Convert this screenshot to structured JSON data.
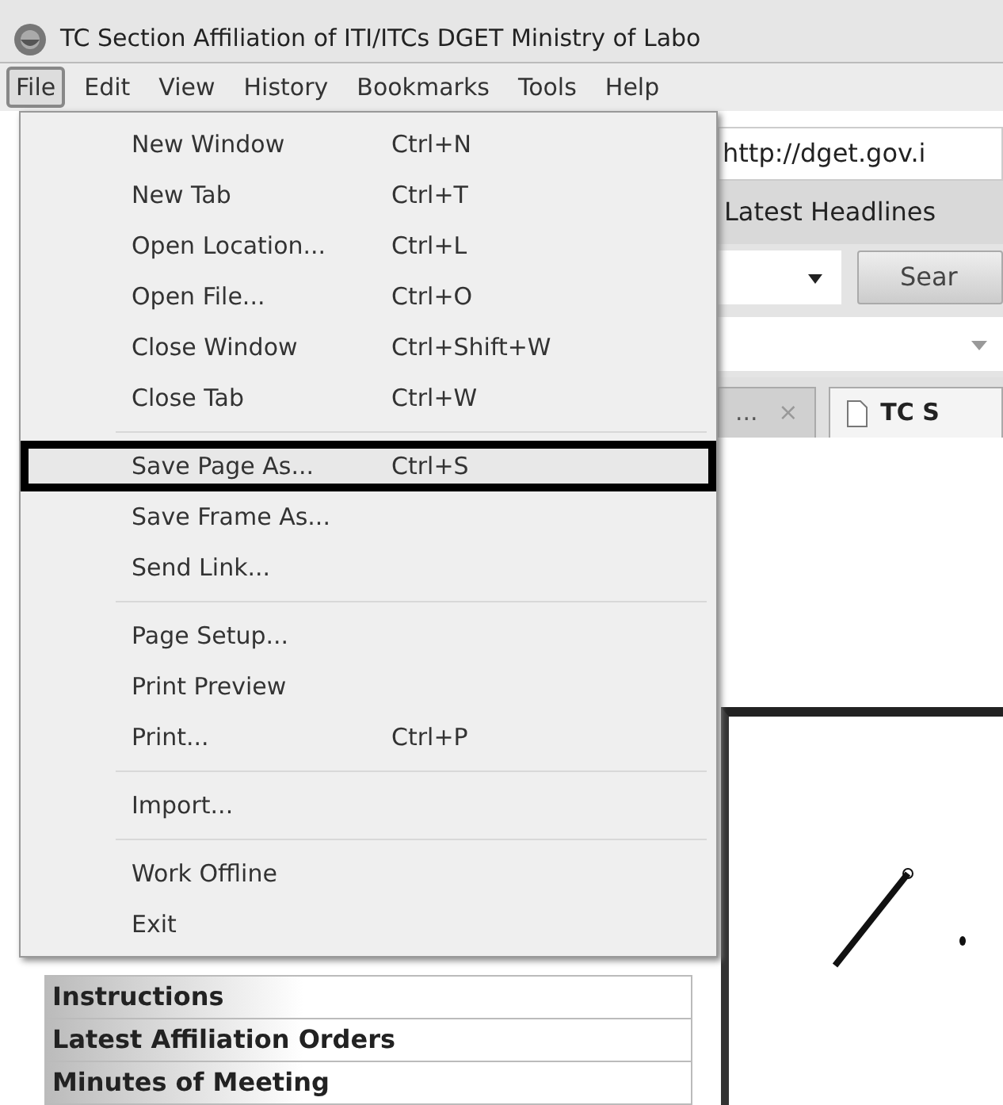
{
  "window": {
    "title": "TC Section Affiliation of ITI/ITCs DGET Ministry of Labo"
  },
  "menubar": [
    {
      "label": "File",
      "selected": true
    },
    {
      "label": "Edit",
      "selected": false
    },
    {
      "label": "View",
      "selected": false
    },
    {
      "label": "History",
      "selected": false
    },
    {
      "label": "Bookmarks",
      "selected": false
    },
    {
      "label": "Tools",
      "selected": false
    },
    {
      "label": "Help",
      "selected": false
    }
  ],
  "file_menu": [
    {
      "kind": "item",
      "label": "New Window",
      "shortcut": "Ctrl+N",
      "selected": false
    },
    {
      "kind": "item",
      "label": "New Tab",
      "shortcut": "Ctrl+T",
      "selected": false
    },
    {
      "kind": "item",
      "label": "Open Location...",
      "shortcut": "Ctrl+L",
      "selected": false
    },
    {
      "kind": "item",
      "label": "Open File...",
      "shortcut": "Ctrl+O",
      "selected": false
    },
    {
      "kind": "item",
      "label": "Close Window",
      "shortcut": "Ctrl+Shift+W",
      "selected": false
    },
    {
      "kind": "item",
      "label": "Close Tab",
      "shortcut": "Ctrl+W",
      "selected": false
    },
    {
      "kind": "separator"
    },
    {
      "kind": "item",
      "label": "Save Page As...",
      "shortcut": "Ctrl+S",
      "selected": true
    },
    {
      "kind": "item",
      "label": "Save Frame As...",
      "selected": false
    },
    {
      "kind": "item",
      "label": "Send Link...",
      "selected": false
    },
    {
      "kind": "separator"
    },
    {
      "kind": "item",
      "label": "Page Setup...",
      "selected": false
    },
    {
      "kind": "item",
      "label": "Print Preview",
      "selected": false
    },
    {
      "kind": "item",
      "label": "Print...",
      "shortcut": "Ctrl+P",
      "selected": false
    },
    {
      "kind": "separator"
    },
    {
      "kind": "item",
      "label": "Import...",
      "selected": false
    },
    {
      "kind": "separator"
    },
    {
      "kind": "item",
      "label": "Work Offline",
      "selected": false
    },
    {
      "kind": "item",
      "label": "Exit",
      "selected": false
    }
  ],
  "address_bar": {
    "value": "http://dget.gov.i"
  },
  "bookmarks_toolbar": {
    "item": "Latest Headlines"
  },
  "search_button": {
    "label": "Sear"
  },
  "tabs": [
    {
      "label": "...",
      "close": "×",
      "selected": false
    },
    {
      "label": "TC S",
      "selected": true
    }
  ],
  "sidebar": [
    {
      "label": "Instructions"
    },
    {
      "label": "Latest Affiliation Orders"
    },
    {
      "label": "Minutes of Meeting"
    }
  ]
}
